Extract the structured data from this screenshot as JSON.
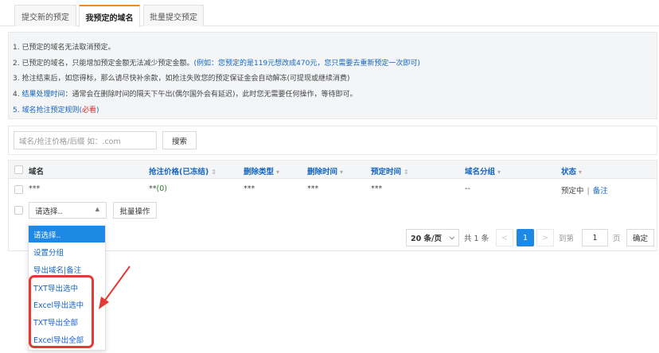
{
  "tabs": [
    {
      "label": "提交新的预定"
    },
    {
      "label": "我预定的域名"
    },
    {
      "label": "批量提交预定"
    }
  ],
  "notice": {
    "line1": "1. 已预定的域名无法取消预定。",
    "line2_prefix": "2. 已预定的域名，只能增加预定金额无法减少预定金额。",
    "line2_example": "(例如：您预定的是119元想改成470元，您只需要去重新预定一次即可)",
    "line3": "3. 抢注结束后，如您得标，那么请尽快补余款，如抢注失败您的预定保证金会自动解冻(可提现或继续消费)",
    "line4_prefix": "4. ",
    "line4_highlight": "结果处理时间",
    "line4_rest": "：通常会在删除时间的隔天下午出(偶尔国外会有延迟)，此时您无需要任何操作，等待即可。",
    "line5_prefix": "5. 域名抢注预定规则(",
    "line5_red": "必看",
    "line5_suffix": ")"
  },
  "search": {
    "placeholder": "域名/抢注价格/后缀 如：.com",
    "button_label": "搜索"
  },
  "table": {
    "headers": {
      "domain": "域名",
      "price": "抢注价格(已冻结)",
      "delete_type": "删除类型",
      "delete_time": "删除时间",
      "reserve_time": "预定时间",
      "group": "域名分组",
      "status": "状态"
    },
    "sort_icon": "⇕",
    "filter_icon": "▾",
    "row": {
      "domain": "***",
      "price_mask": "**",
      "price_value": "(0)",
      "delete_type": "***",
      "delete_time": "***",
      "reserve_time": "***",
      "group": "--",
      "status": "预定中",
      "separator": "|",
      "note": "备注"
    }
  },
  "batch": {
    "select_value": "请选择..",
    "button_label": "批量操作"
  },
  "pager": {
    "per_page": "20 条/页",
    "total": "共 1 条",
    "prev": "<",
    "current": "1",
    "next": ">",
    "goto_label": "到第",
    "goto_value": "1",
    "page_suffix": "页",
    "confirm": "确定"
  },
  "dropdown": {
    "options": [
      "请选择..",
      "设置分组",
      "导出域名|备注",
      "TXT导出选中",
      "Excel导出选中",
      "TXT导出全部",
      "Excel导出全部"
    ]
  },
  "colors": {
    "accent": "#1e88e5",
    "link": "#1565c0",
    "active_tab": "#f08a24",
    "annotation": "#e53935"
  }
}
